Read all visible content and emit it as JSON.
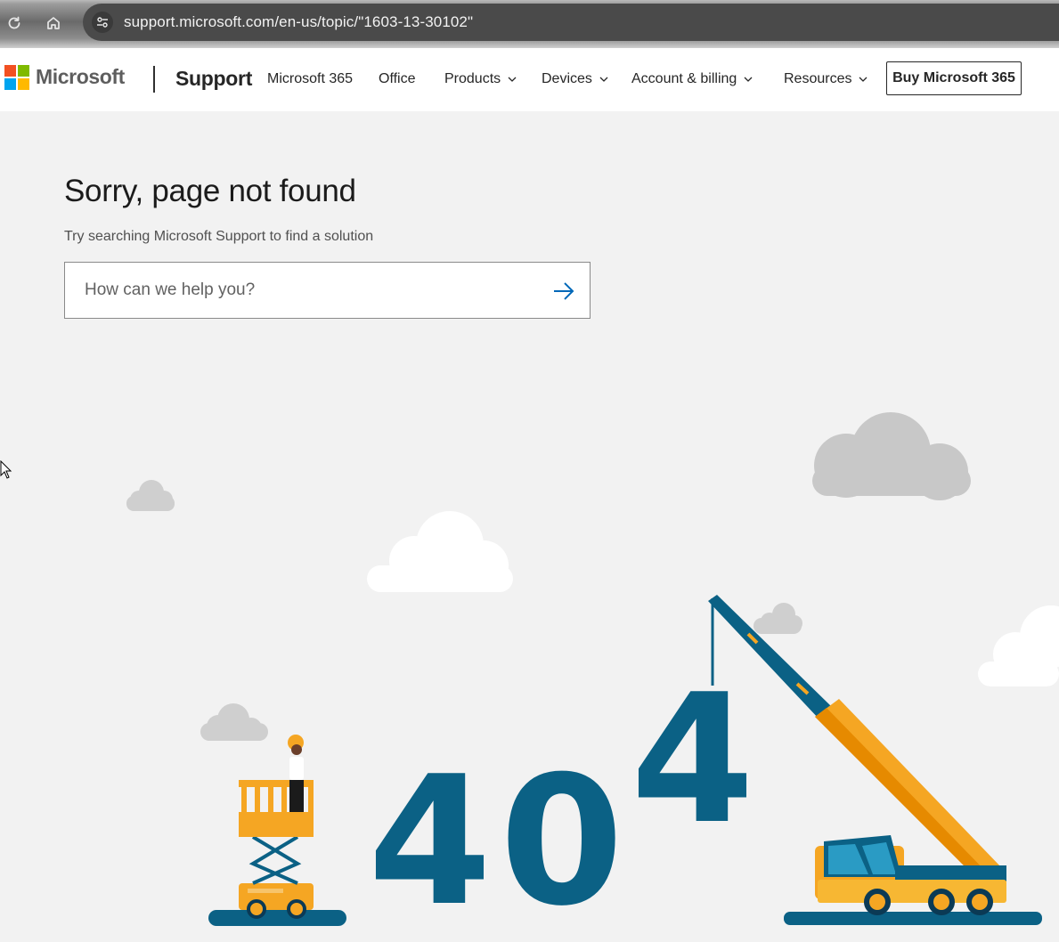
{
  "browser": {
    "url": "support.microsoft.com/en-us/topic/\"1603-13-30102\"",
    "reload_icon": "reload-icon",
    "home_icon": "home-icon",
    "site_info_icon": "tune-icon"
  },
  "header": {
    "brand": "Microsoft",
    "section": "Support",
    "nav": [
      {
        "label": "Microsoft 365",
        "dropdown": false
      },
      {
        "label": "Office",
        "dropdown": false
      },
      {
        "label": "Products",
        "dropdown": true
      },
      {
        "label": "Devices",
        "dropdown": true
      },
      {
        "label": "Account & billing",
        "dropdown": true
      },
      {
        "label": "Resources",
        "dropdown": true
      }
    ],
    "cta": "Buy Microsoft 365"
  },
  "main": {
    "title": "Sorry, page not found",
    "subtitle": "Try searching Microsoft Support to find a solution",
    "search": {
      "placeholder": "How can we help you?",
      "value": ""
    }
  },
  "illustration": {
    "digits": [
      "4",
      "0",
      "4"
    ]
  },
  "colors": {
    "logo_red": "#f25022",
    "logo_green": "#7fba00",
    "logo_blue": "#00a4ef",
    "logo_yellow": "#ffb900",
    "accent_blue": "#0067b8",
    "digit_blue": "#0b6185",
    "crane_orange": "#f5a623"
  }
}
